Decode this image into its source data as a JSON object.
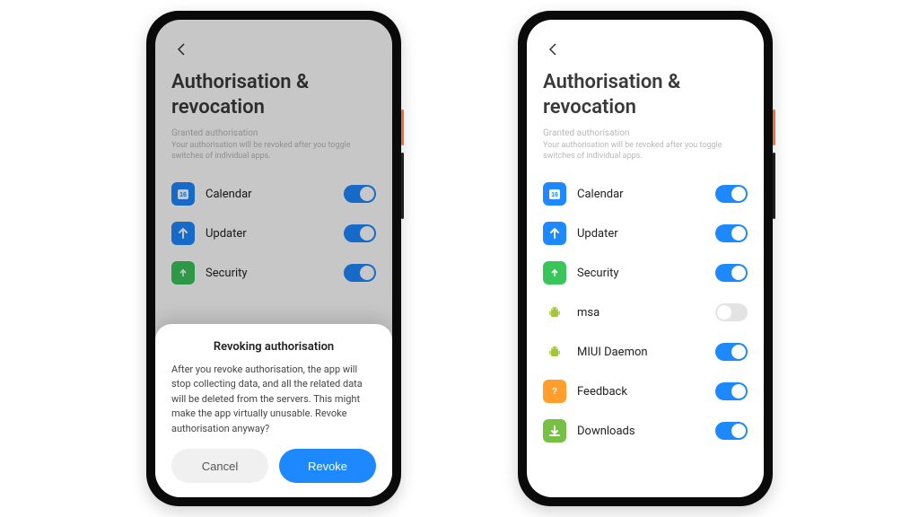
{
  "left": {
    "title": "Authorisation & revocation",
    "section_label": "Granted authorisation",
    "section_help": "Your authorisation will be revoked after you toggle switches of individual apps.",
    "apps": [
      {
        "id": "calendar",
        "name": "Calendar",
        "on": true,
        "icon": "calendar-icon",
        "bg": "ic-blue"
      },
      {
        "id": "updater",
        "name": "Updater",
        "on": true,
        "icon": "arrow-up-icon",
        "bg": "ic-blue"
      },
      {
        "id": "security",
        "name": "Security",
        "on": true,
        "icon": "shield-icon",
        "bg": "ic-green"
      }
    ],
    "dialog": {
      "title": "Revoking authorisation",
      "body": "After you revoke authorisation, the app will stop collecting data, and all the related data will be deleted from the servers. This might make the app virtually unusable. Revoke authorisation anyway?",
      "cancel": "Cancel",
      "confirm": "Revoke"
    }
  },
  "right": {
    "title": "Authorisation & revocation",
    "section_label": "Granted authorisation",
    "section_help": "Your authorisation will be revoked after you toggle switches of individual apps.",
    "apps": [
      {
        "id": "calendar",
        "name": "Calendar",
        "on": true,
        "icon": "calendar-icon",
        "bg": "ic-blue"
      },
      {
        "id": "updater",
        "name": "Updater",
        "on": true,
        "icon": "arrow-up-icon",
        "bg": "ic-blue"
      },
      {
        "id": "security",
        "name": "Security",
        "on": true,
        "icon": "shield-icon",
        "bg": "ic-green"
      },
      {
        "id": "msa",
        "name": "msa",
        "on": false,
        "icon": "android-icon",
        "bg": "ic-android"
      },
      {
        "id": "miui",
        "name": "MIUI Daemon",
        "on": true,
        "icon": "android-icon",
        "bg": "ic-android"
      },
      {
        "id": "feedback",
        "name": "Feedback",
        "on": true,
        "icon": "question-icon",
        "bg": "ic-orange"
      },
      {
        "id": "downloads",
        "name": "Downloads",
        "on": true,
        "icon": "download-icon",
        "bg": "ic-lime"
      }
    ]
  }
}
